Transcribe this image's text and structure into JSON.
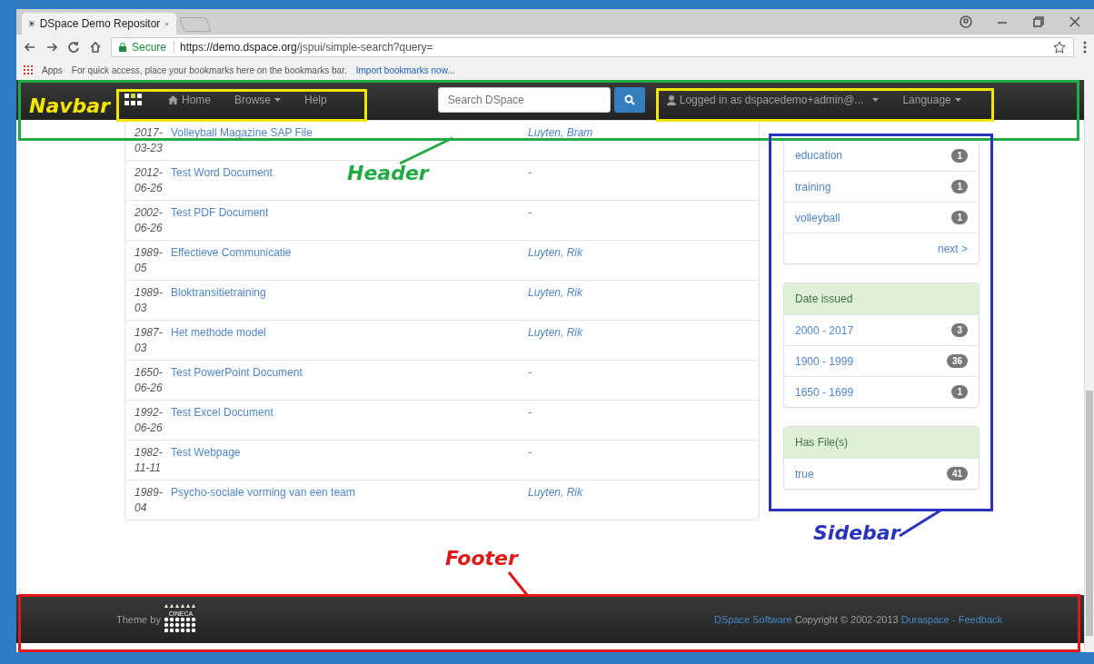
{
  "browser": {
    "tab_title": "DSpace Demo Repositor",
    "secure_label": "Secure",
    "url_host": "https://demo.dspace.org",
    "url_path": "/jspui/simple-search?query=",
    "bookmarks_apps": "Apps",
    "bookmarks_hint": "For quick access, place your bookmarks here on the bookmarks bar.",
    "bookmarks_link": "Import bookmarks now..."
  },
  "navbar": {
    "links": [
      {
        "label": "Home",
        "kind": "home"
      },
      {
        "label": "Browse",
        "kind": "dropdown"
      },
      {
        "label": "Help",
        "kind": "plain"
      }
    ],
    "search": {
      "placeholder": "Search DSpace"
    },
    "user": "Logged in as dspacedemo+admin@...",
    "language": "Language"
  },
  "results": [
    {
      "date": "2017-03-23",
      "title": "Volleyball Magazine SAP File",
      "author": "Luyten, Bram"
    },
    {
      "date": "2012-06-26",
      "title": "Test Word Document",
      "author": "-"
    },
    {
      "date": "2002-06-26",
      "title": "Test PDF Document",
      "author": "-"
    },
    {
      "date": "1989-05",
      "title": "Effectieve Communicatie",
      "author": "Luyten, Rik"
    },
    {
      "date": "1989-03",
      "title": "Bloktransitietraining",
      "author": "Luyten, Rik"
    },
    {
      "date": "1987-03",
      "title": "Het methode model",
      "author": "Luyten, Rik"
    },
    {
      "date": "1650-06-26",
      "title": "Test PowerPoint Document",
      "author": "-"
    },
    {
      "date": "1992-06-26",
      "title": "Test Excel Document",
      "author": "-"
    },
    {
      "date": "1982-11-11",
      "title": "Test Webpage",
      "author": "-"
    },
    {
      "date": "1989-04",
      "title": "Psycho-sociale vorming van een team",
      "author": "Luyten, Rik"
    }
  ],
  "sidebar": [
    {
      "items": [
        {
          "label": "education",
          "count": "1"
        },
        {
          "label": "training",
          "count": "1"
        },
        {
          "label": "volleyball",
          "count": "1"
        }
      ],
      "next": "next >"
    },
    {
      "title": "Date issued",
      "items": [
        {
          "label": "2000 - 2017",
          "count": "3"
        },
        {
          "label": "1900 - 1999",
          "count": "36"
        },
        {
          "label": "1650 - 1699",
          "count": "1"
        }
      ]
    },
    {
      "title": "Has File(s)",
      "items": [
        {
          "label": "true",
          "count": "41"
        }
      ]
    }
  ],
  "footer": {
    "theme_by": "Theme by",
    "logo_text": "CINECA",
    "software_link": "DSpace Software",
    "copyright": "Copyright © 2002-2013",
    "duraspace_link": "Duraspace",
    "separator": "-",
    "feedback_link": "Feedback"
  },
  "annotations": {
    "boxes": [
      {
        "kind": "nav-links",
        "color": "#f2e600"
      },
      {
        "kind": "user-menu",
        "color": "#f2e600"
      },
      {
        "kind": "header",
        "color": "#22aa44"
      },
      {
        "kind": "sidebar",
        "color": "#2a33c0"
      },
      {
        "kind": "footer",
        "color": "#e01818"
      }
    ],
    "labels": [
      {
        "kind": "navbar",
        "text": "Navbar",
        "color": "#f2e600"
      },
      {
        "kind": "header",
        "text": "Header",
        "color": "#22aa44"
      },
      {
        "kind": "sidebar",
        "text": "Sidebar",
        "color": "#2a33c0"
      },
      {
        "kind": "footer",
        "text": "Footer",
        "color": "#e01818"
      }
    ]
  }
}
